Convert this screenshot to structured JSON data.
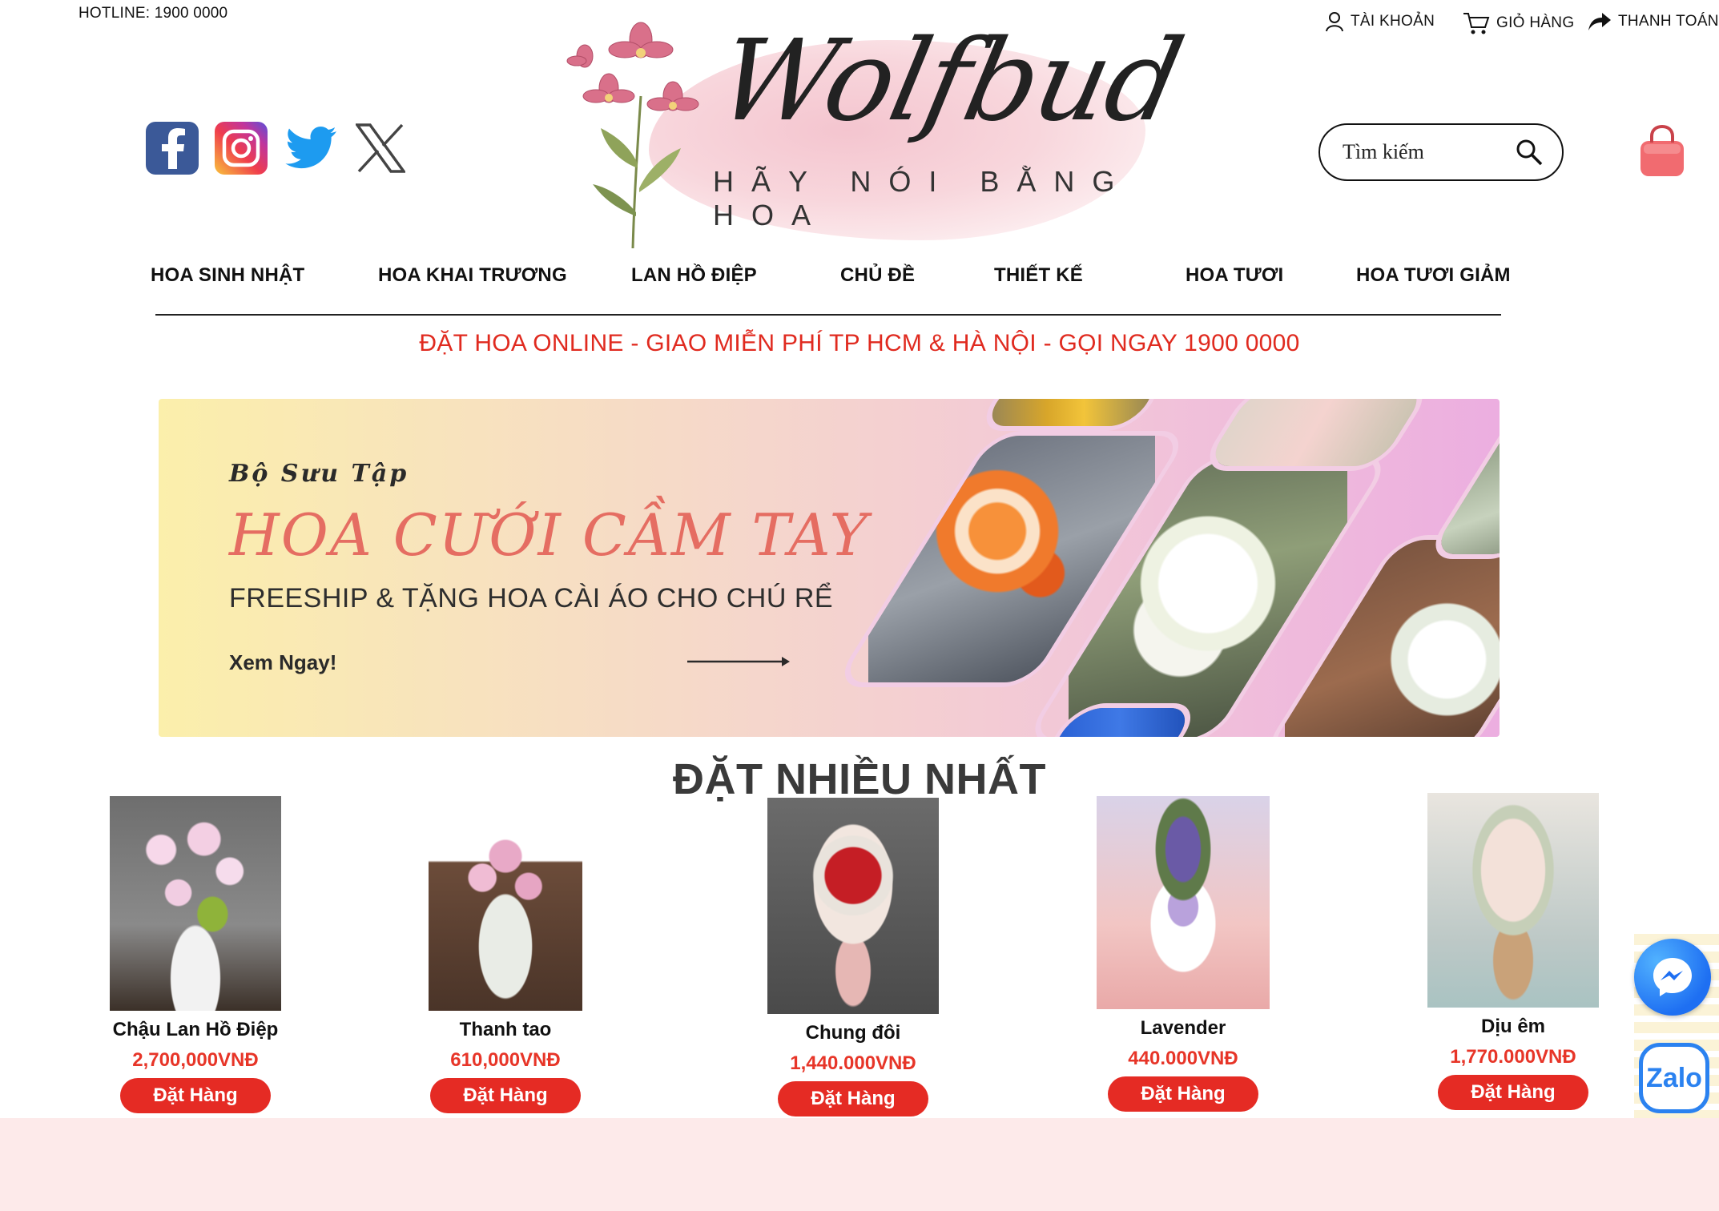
{
  "topbar": {
    "hotline": "HOTLINE: 1900 0000",
    "account": "TÀI KHOẢN",
    "cart": "GIỎ HÀNG",
    "checkout": "THANH TOÁN"
  },
  "logo": {
    "script": "Wolfbud",
    "tagline": "HÃY NÓI BẰNG HOA"
  },
  "social": [
    "facebook-icon",
    "instagram-icon",
    "twitter-icon",
    "x-icon"
  ],
  "search": {
    "placeholder": "Tìm kiếm"
  },
  "nav": [
    "HOA SINH NHẬT",
    "HOA KHAI TRƯƠNG",
    "LAN HỒ ĐIỆP",
    "CHỦ ĐỀ",
    "THIẾT KẾ",
    "HOA TƯƠI",
    "HOA TƯƠI GIẢM"
  ],
  "promo": "ĐẶT HOA ONLINE - GIAO MIỄN PHÍ TP HCM & HÀ NỘI - GỌI NGAY 1900 0000",
  "banner": {
    "subtitle": "Bộ Sưu Tập",
    "title": "HOA CƯỚI CẦM TAY",
    "freeship": "FREESHIP & TẶNG HOA CÀI ÁO CHO CHÚ RỂ",
    "cta": "Xem Ngay!"
  },
  "bestsellers": {
    "title": "ĐẶT NHIỀU NHẤT",
    "button_label": "Đặt Hàng",
    "products": [
      {
        "name": "Chậu Lan Hồ Điệp",
        "price": "2,700,000VNĐ"
      },
      {
        "name": "Thanh tao",
        "price": "610,000VNĐ"
      },
      {
        "name": "Chung đôi",
        "price": "1,440.000VNĐ"
      },
      {
        "name": "Lavender",
        "price": "440.000VNĐ"
      },
      {
        "name": "Dịu êm",
        "price": "1,770.000VNĐ"
      }
    ]
  },
  "floating": {
    "zalo": "Zalo"
  },
  "colors": {
    "accent_red": "#e52b24",
    "promo_red": "#e02a1f",
    "footer_pink": "#fdeaea"
  }
}
